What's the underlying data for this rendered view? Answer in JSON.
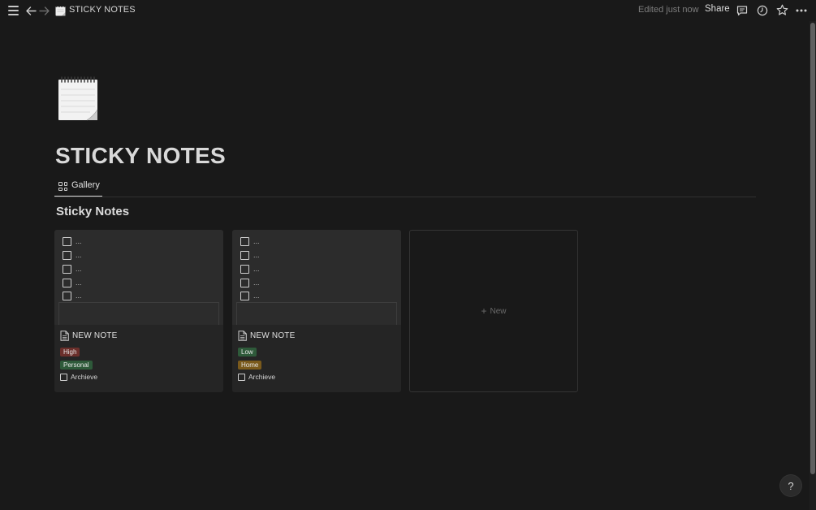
{
  "topbar": {
    "breadcrumb": "STICKY NOTES",
    "edited": "Edited just now",
    "share": "Share",
    "icons": [
      "menu-icon",
      "back-arrow-icon",
      "forward-arrow-icon",
      "notepad-icon",
      "comment-icon",
      "clock-icon",
      "star-icon",
      "more-icon"
    ]
  },
  "page": {
    "title": "STICKY NOTES",
    "icon": "spiral-notepad-icon"
  },
  "tabs": [
    {
      "label": "Gallery",
      "icon": "gallery-icon",
      "active": true
    }
  ],
  "section": {
    "title": "Sticky Notes"
  },
  "cards": [
    {
      "checklist": [
        "...",
        "...",
        "...",
        "...",
        "..."
      ],
      "title": "NEW NOTE",
      "priority": {
        "label": "High",
        "color": "#6b2f2b"
      },
      "category": {
        "label": "Personal",
        "color": "#2e5a3a"
      },
      "archive_label": "Archieve"
    },
    {
      "checklist": [
        "...",
        "...",
        "...",
        "...",
        "..."
      ],
      "title": "NEW NOTE",
      "priority": {
        "label": "Low",
        "color": "#2e5a3a"
      },
      "category": {
        "label": "Home",
        "color": "#7a5a1c"
      },
      "archive_label": "Archieve"
    }
  ],
  "new_card": {
    "label": "New",
    "icon": "plus-icon"
  },
  "help": {
    "label": "?"
  }
}
